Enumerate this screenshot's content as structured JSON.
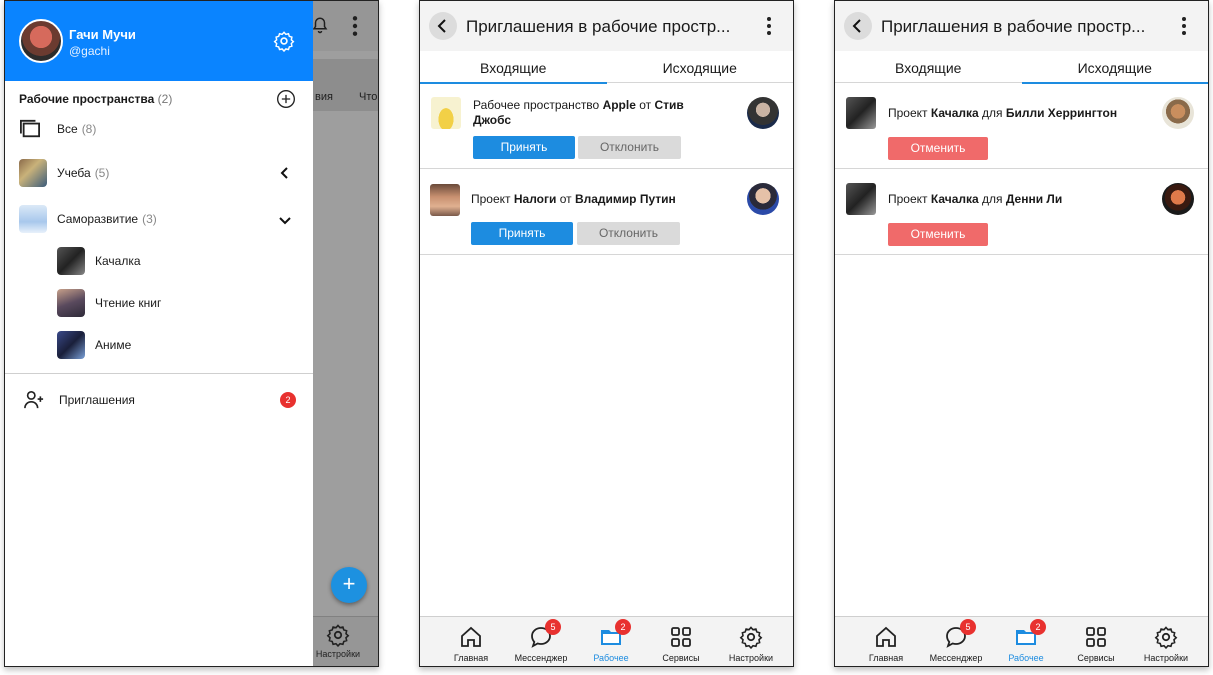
{
  "drawer_screen": {
    "user": {
      "name": "Гачи Мучи",
      "handle": "@gachi"
    },
    "workspaces_title": "Рабочие пространства",
    "workspaces_count": "(2)",
    "items": [
      {
        "label": "Все",
        "count": "(8)"
      },
      {
        "label": "Учеба",
        "count": "(5)"
      },
      {
        "label": "Саморазвитие",
        "count": "(3)"
      }
    ],
    "sub_items": [
      {
        "label": "Качалка"
      },
      {
        "label": "Чтение книг"
      },
      {
        "label": "Аниме"
      }
    ],
    "invitations": {
      "label": "Приглашения",
      "badge": "2"
    },
    "background": {
      "card1": "вия",
      "card2": "Что",
      "settings_label": "Настройки",
      "fab": "+"
    }
  },
  "incoming_screen": {
    "title": "Приглашения в рабочие простр...",
    "tabs": {
      "incoming": "Входящие",
      "outgoing": "Исходящие",
      "active": "incoming"
    },
    "invites": [
      {
        "prefix": "Рабочее пространство ",
        "name": "Apple",
        "from": " от ",
        "sender": "Стив Джобс",
        "accept": "Принять",
        "decline": "Отклонить"
      },
      {
        "prefix": "Проект ",
        "name": "Налоги",
        "from": " от ",
        "sender": "Владимир Путин",
        "accept": "Принять",
        "decline": "Отклонить"
      }
    ]
  },
  "outgoing_screen": {
    "title": "Приглашения в рабочие простр...",
    "tabs": {
      "incoming": "Входящие",
      "outgoing": "Исходящие",
      "active": "outgoing"
    },
    "invites": [
      {
        "prefix": "Проект ",
        "name": "Качалка",
        "to": " для ",
        "recipient": "Билли Херрингтон",
        "cancel": "Отменить"
      },
      {
        "prefix": "Проект ",
        "name": "Качалка",
        "to": " для ",
        "recipient": "Денни Ли",
        "cancel": "Отменить"
      }
    ]
  },
  "bottom_nav": {
    "items": [
      {
        "label": "Главная",
        "icon": "home-icon"
      },
      {
        "label": "Мессенджер",
        "icon": "chat-icon",
        "badge": "5"
      },
      {
        "label": "Рабочее",
        "icon": "folder-icon",
        "badge": "2",
        "active": true
      },
      {
        "label": "Сервисы",
        "icon": "grid-icon"
      },
      {
        "label": "Настройки",
        "icon": "gear-icon"
      }
    ]
  },
  "colors": {
    "accent": "#0a84ff",
    "primary_button": "#1d8ce0",
    "cancel_button": "#f06a6a",
    "badge": "#e8312f"
  }
}
